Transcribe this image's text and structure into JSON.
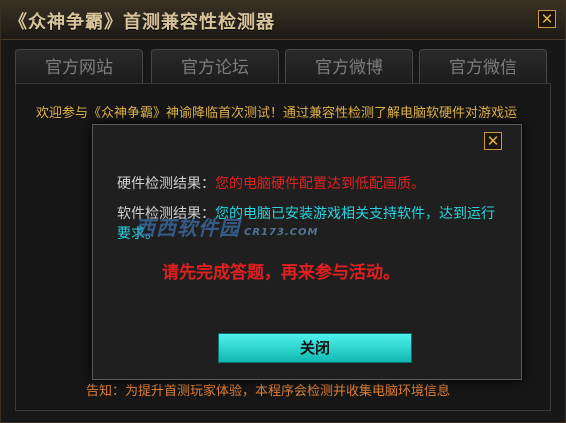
{
  "window": {
    "title": "《众神争霸》首测兼容性检测器",
    "close_glyph": "✕"
  },
  "tabs": [
    {
      "label": "官方网站"
    },
    {
      "label": "官方论坛"
    },
    {
      "label": "官方微博"
    },
    {
      "label": "官方微信"
    }
  ],
  "intro": "欢迎参与《众神争霸》神谕降临首次测试！通过兼容性检测了解电脑软硬件对游戏运",
  "footer_notice": "告知：为提升首测玩家体验，本程序会检测并收集电脑环境信息",
  "dialog": {
    "close_glyph": "✕",
    "hardware_label": "硬件检测结果：",
    "hardware_result": "您的电脑硬件配置达到低配画质。",
    "software_label": "软件检测结果：",
    "software_result": "您的电脑已安装游戏相关支持软件，达到运行要求。",
    "prompt": "请先完成答题，再来参与活动。",
    "close_button": "关闭"
  },
  "watermark": {
    "text": "西西软件园",
    "sub": "CR173.COM"
  },
  "colors": {
    "accent_gold": "#e0b24a",
    "result_red": "#e02020",
    "result_cyan": "#27d4e0",
    "button_cyan": "#2fe0da"
  }
}
